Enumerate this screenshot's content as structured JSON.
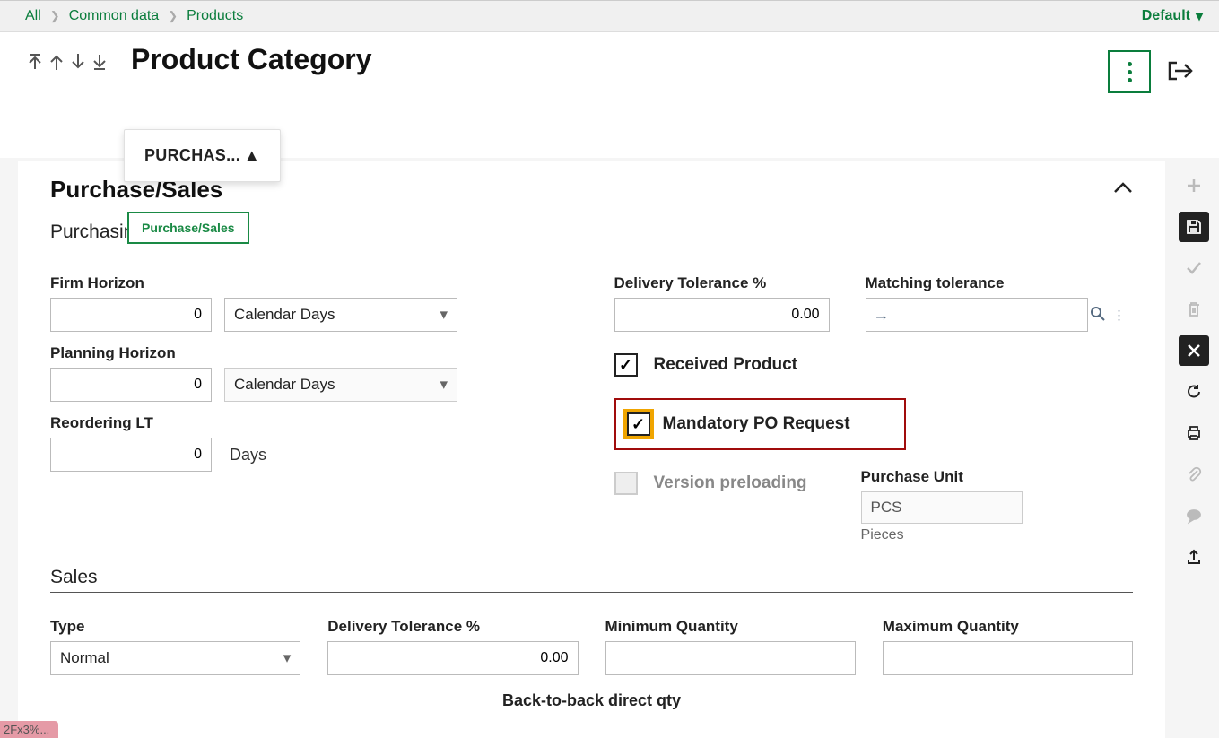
{
  "breadcrumb": {
    "items": [
      "All",
      "Common data",
      "Products"
    ],
    "right_label": "Default"
  },
  "header": {
    "title": "Product Category",
    "tab_label": "PURCHAS...",
    "tooltip": "Purchase/Sales"
  },
  "section": {
    "title": "Purchase/Sales",
    "purchasing_title": "Purchasing",
    "sales_title": "Sales"
  },
  "purchasing": {
    "firm_horizon_label": "Firm Horizon",
    "firm_horizon_value": "0",
    "firm_horizon_unit": "Calendar Days",
    "planning_horizon_label": "Planning Horizon",
    "planning_horizon_value": "0",
    "planning_horizon_unit": "Calendar Days",
    "reordering_lt_label": "Reordering LT",
    "reordering_lt_value": "0",
    "reordering_lt_unit": "Days",
    "delivery_tol_label": "Delivery Tolerance %",
    "delivery_tol_value": "0.00",
    "matching_tol_label": "Matching tolerance",
    "matching_tol_value": "",
    "received_product_label": "Received Product",
    "mandatory_po_label": "Mandatory PO Request",
    "version_preloading_label": "Version preloading",
    "purchase_unit_label": "Purchase Unit",
    "purchase_unit_value": "PCS",
    "purchase_unit_desc": "Pieces"
  },
  "sales": {
    "type_label": "Type",
    "type_value": "Normal",
    "delivery_tol_label": "Delivery Tolerance %",
    "delivery_tol_value": "0.00",
    "min_qty_label": "Minimum Quantity",
    "min_qty_value": "",
    "max_qty_label": "Maximum Quantity",
    "max_qty_value": "",
    "b2b_label": "Back-to-back direct qty"
  },
  "bottom_tag": "2Fx3%..."
}
